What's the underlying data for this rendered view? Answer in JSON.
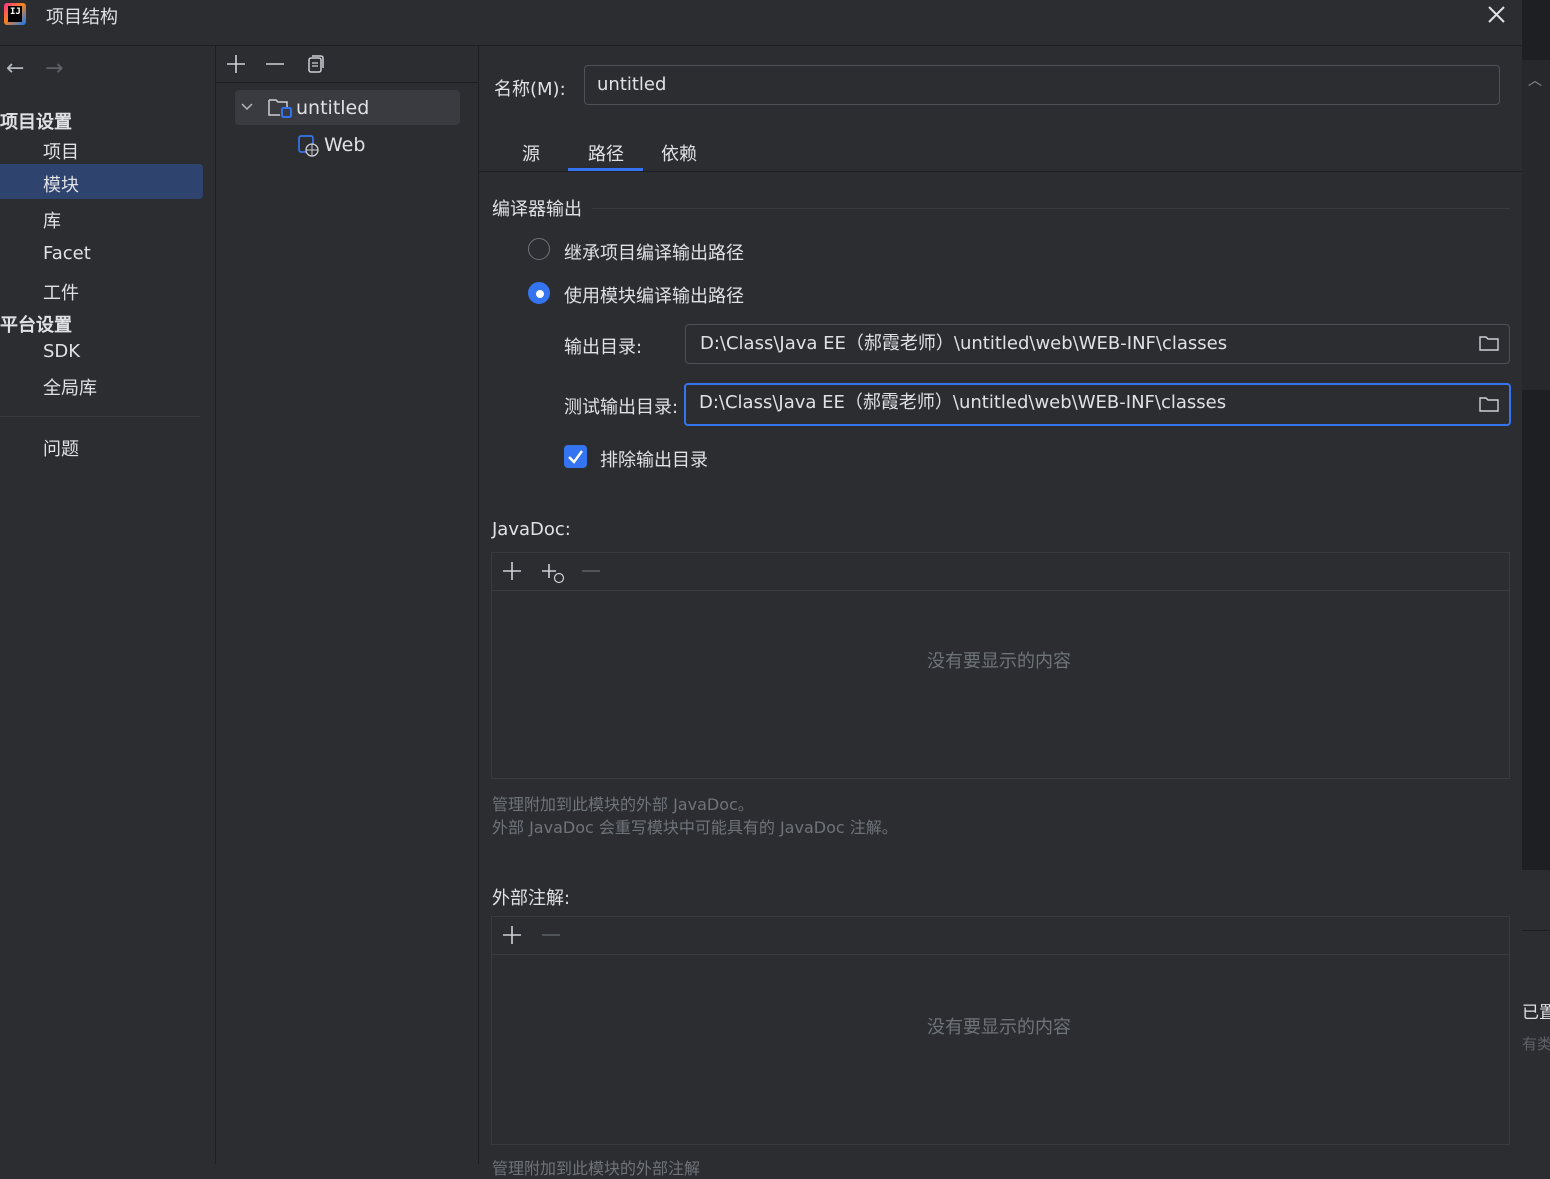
{
  "window": {
    "title": "项目结构",
    "close_glyph": "✕"
  },
  "nav": {
    "back": "←",
    "forward": "→",
    "project_settings": "项目设置",
    "items_project": [
      "项目",
      "模块",
      "库",
      "Facet",
      "工件"
    ],
    "platform_settings": "平台设置",
    "items_platform": [
      "SDK",
      "全局库"
    ],
    "problems": "问题",
    "selected": "模块"
  },
  "tree": {
    "toolbar": {
      "add": "+",
      "remove": "—",
      "copy": "⧉"
    },
    "nodes": [
      {
        "label": "untitled",
        "expanded": true,
        "selected": true
      },
      {
        "label": "Web",
        "child": true
      }
    ]
  },
  "module": {
    "name_label": "名称(M):",
    "name_value": "untitled",
    "tabs": [
      "源",
      "路径",
      "依赖"
    ],
    "active_tab": "路径"
  },
  "compiler": {
    "title": "编译器输出",
    "inherit_label": "继承项目编译输出路径",
    "use_module_label": "使用模块编译输出路径",
    "selected_option": "use_module",
    "output_label": "输出目录:",
    "output_value": "D:\\Class\\Java EE（郝霞老师）\\untitled\\web\\WEB-INF\\classes",
    "test_output_label": "测试输出目录:",
    "test_output_value": "D:\\Class\\Java EE（郝霞老师）\\untitled\\web\\WEB-INF\\classes",
    "exclude_label": "排除输出目录",
    "exclude_checked": true
  },
  "javadoc": {
    "title": "JavaDoc:",
    "empty": "没有要显示的内容",
    "hint1": "管理附加到此模块的外部 JavaDoc。",
    "hint2": "外部 JavaDoc 会重写模块中可能具有的 JavaDoc 注解。"
  },
  "annotations": {
    "title": "外部注解:",
    "empty": "没有要显示的内容",
    "hint": "管理附加到此模块的外部注解"
  },
  "background_window": {
    "text1": "已置",
    "text2": "有类"
  },
  "colors": {
    "accent": "#3574f0",
    "background": "#2b2d30",
    "selection": "#2e436e"
  }
}
